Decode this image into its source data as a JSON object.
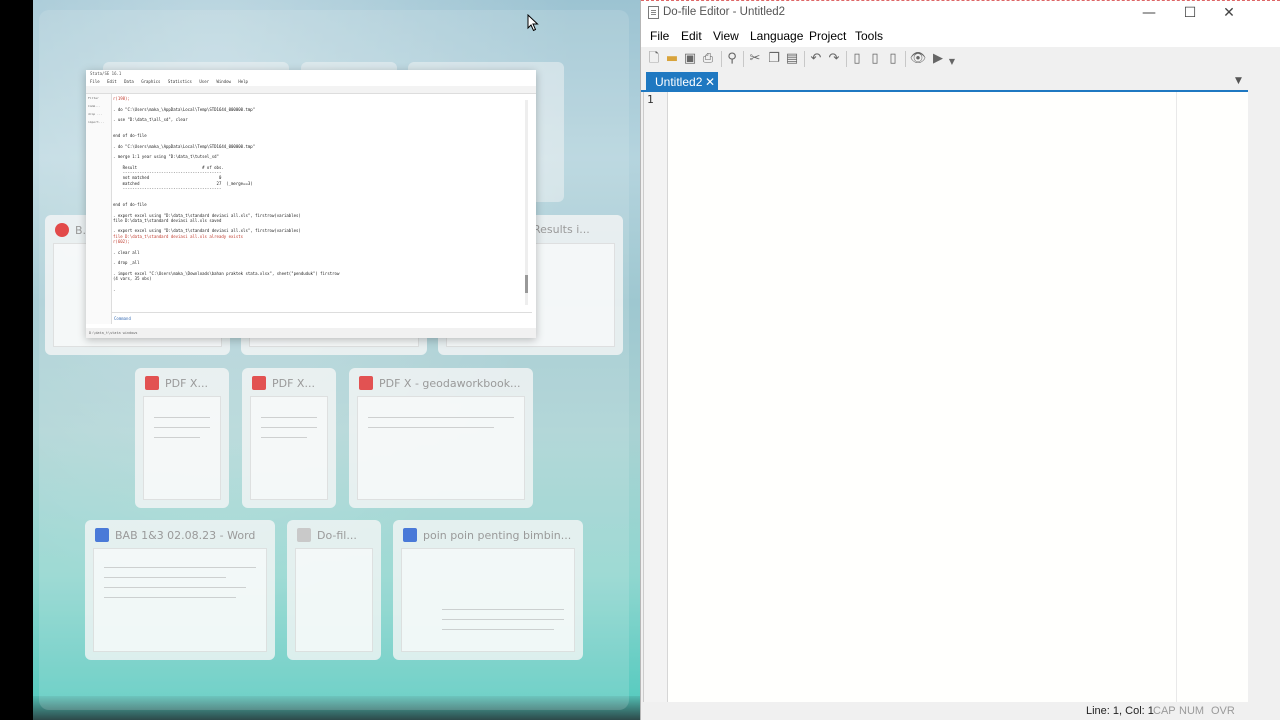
{
  "snap_assist": {
    "stata_window": {
      "title": "Stata/SE 16.1",
      "menu": [
        "File",
        "Edit",
        "Data",
        "Graphics",
        "Statistics",
        "User",
        "Window",
        "Help"
      ],
      "side_items": [
        "Filter",
        "Comm...",
        "drop ...",
        "import..."
      ],
      "results_lines": [
        "r(198);",
        "",
        ". do \"C:\\Users\\maka_\\AppData\\Local\\Temp\\STD1644_000000.tmp\"",
        "",
        ". use \"D:\\data_t\\all_sd\", clear",
        "",
        "",
        "end of do-file",
        "",
        ". do \"C:\\Users\\maka_\\AppData\\Local\\Temp\\STD1644_000000.tmp\"",
        "",
        ". merge 1:1 year using \"D:\\data_t\\tutsel_sd\"",
        "",
        "    Result                           # of obs.",
        "    -----------------------------------------",
        "    not matched                             0",
        "    matched                                27  (_merge==3)",
        "    -----------------------------------------",
        "",
        "",
        "end of do-file",
        "",
        ". export excel using \"D:\\data_t\\standard deviasi all.xls\", firstrow(variables)",
        "file D:\\data_t\\standard deviasi all.xls saved",
        "",
        ". export excel using \"D:\\data_t\\standard deviasi all.xls\", firstrow(variables)",
        "file D:\\data_t\\standard deviasi all.xls already exists",
        "r(602);",
        "",
        ". clear all",
        "",
        ". drop _all",
        "",
        ". import excel \"C:\\Users\\maka_\\Downloads\\bahan praktek stata.xlsx\", sheet(\"penduduk\") firstrow",
        "(4 vars, 35 obs)",
        "",
        "."
      ],
      "command_label": "Command",
      "status_text": "D:\\data_t\\stata windows"
    },
    "thumbnails": [
      {
        "title": "B...",
        "icon_color": "#e24a4a"
      },
      {
        "title": "Results i...",
        "icon_color": "#b0b0b0"
      },
      {
        "title": "PDF X...",
        "icon_color": "#e25252"
      },
      {
        "title": "PDF X...",
        "icon_color": "#e25252"
      },
      {
        "title": "PDF X - geodaworkbook...",
        "icon_color": "#e25252"
      },
      {
        "title": "BAB 1&3 02.08.23 - Word",
        "icon_color": "#4a7ad8"
      },
      {
        "title": "Do-fil...",
        "icon_color": "#c9c9c9"
      },
      {
        "title": "poin poin penting bimbin...",
        "icon_color": "#4a7ad8"
      }
    ]
  },
  "editor": {
    "title": "Do-file Editor - Untitled2",
    "window_buttons": {
      "minimize": "—",
      "maximize": "☐",
      "close": "✕"
    },
    "menu": [
      "File",
      "Edit",
      "View",
      "Language",
      "Project",
      "Tools"
    ],
    "tab": {
      "label": "Untitled2",
      "close": "✕"
    },
    "line_numbers": [
      "1"
    ],
    "status": {
      "position": "Line: 1, Col: 1",
      "cap": "CAP",
      "num": "NUM",
      "ovr": "OVR"
    }
  },
  "icons": {
    "new": "new-file-icon",
    "open": "open-folder-icon",
    "save": "save-icon",
    "print": "print-icon",
    "find": "find-icon",
    "cut": "cut-icon",
    "copy": "copy-icon",
    "paste": "paste-icon",
    "undo": "undo-icon",
    "redo": "redo-icon",
    "bookmark": "bookmark-icon",
    "preview": "preview-icon",
    "execute": "execute-icon"
  }
}
